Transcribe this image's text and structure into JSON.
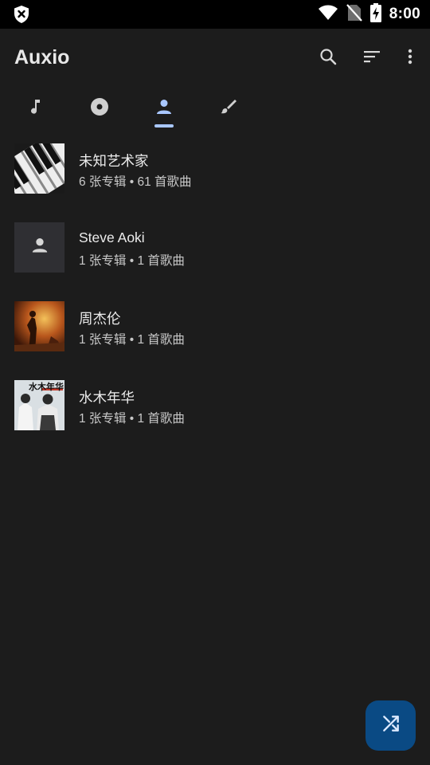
{
  "status_bar": {
    "time": "8:00",
    "icons": [
      "shield-x-icon",
      "wifi-icon",
      "no-sim-icon",
      "battery-charging-icon"
    ]
  },
  "app_bar": {
    "title": "Auxio",
    "actions": [
      "search-icon",
      "sort-icon",
      "more-vert-icon"
    ]
  },
  "tabs": [
    {
      "name": "songs",
      "icon": "music-note-icon",
      "selected": false
    },
    {
      "name": "albums",
      "icon": "album-icon",
      "selected": false
    },
    {
      "name": "artists",
      "icon": "person-icon",
      "selected": true
    },
    {
      "name": "genres",
      "icon": "brush-icon",
      "selected": false
    }
  ],
  "artists": [
    {
      "name": "未知艺术家",
      "info": "6 张专辑 • 61 首歌曲",
      "art": "piano-keys"
    },
    {
      "name": "Steve Aoki",
      "info": "1 张专辑 • 1 首歌曲",
      "art": "placeholder-person"
    },
    {
      "name": "周杰伦",
      "info": "1 张专辑 • 1 首歌曲",
      "art": "album-cover-orange"
    },
    {
      "name": "水木年华",
      "info": "1 张专辑 • 1 首歌曲",
      "art": "album-cover-duo",
      "art_text": "水木年华"
    }
  ],
  "fab": {
    "icon": "shuffle-icon"
  },
  "colors": {
    "background": "#1c1c1c",
    "status_bar": "#000000",
    "accent": "#a9c7ff",
    "fab": "#0a4a84"
  }
}
